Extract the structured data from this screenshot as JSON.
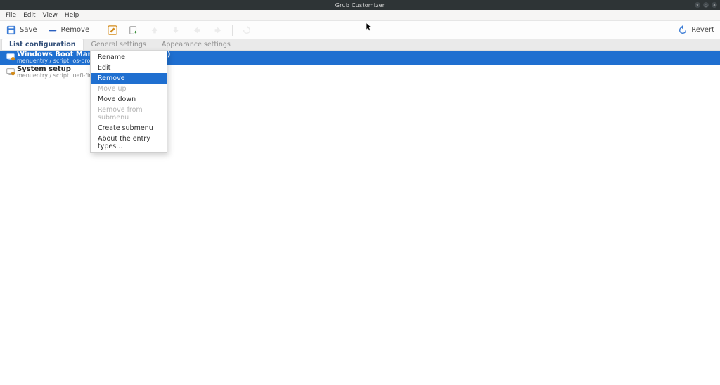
{
  "window": {
    "title": "Grub Customizer"
  },
  "menubar": {
    "items": [
      "File",
      "Edit",
      "View",
      "Help"
    ]
  },
  "toolbar": {
    "save_label": "Save",
    "remove_label": "Remove",
    "revert_label": "Revert"
  },
  "tabs": {
    "items": [
      "List configuration",
      "General settings",
      "Appearance settings"
    ],
    "active_index": 0
  },
  "entries": [
    {
      "title": "Windows Boot Manager (on /dev/sdb2)",
      "sub": "menuentry / script: os-prober",
      "selected": true
    },
    {
      "title": "System setup",
      "sub": "menuentry / script: uefi-firmware",
      "selected": false
    }
  ],
  "context_menu": {
    "highlight_index": 2,
    "items": [
      {
        "label": "Rename",
        "enabled": true
      },
      {
        "label": "Edit",
        "enabled": true
      },
      {
        "label": "Remove",
        "enabled": true
      },
      {
        "label": "Move up",
        "enabled": false
      },
      {
        "label": "Move down",
        "enabled": true
      },
      {
        "label": "Remove from submenu",
        "enabled": false
      },
      {
        "label": "Create submenu",
        "enabled": true
      },
      {
        "label": "About the entry types...",
        "enabled": true
      }
    ]
  }
}
